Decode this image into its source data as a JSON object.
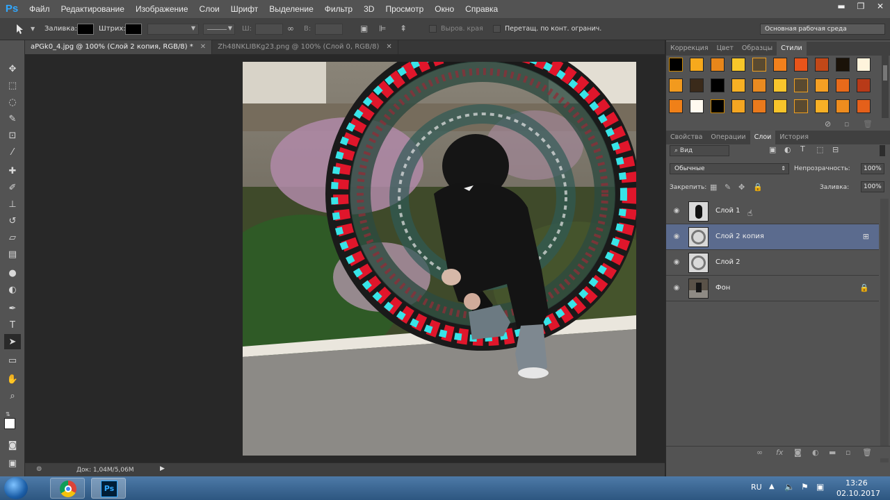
{
  "menubar": {
    "logo": "Ps",
    "items": [
      "Файл",
      "Редактирование",
      "Изображение",
      "Слои",
      "Шрифт",
      "Выделение",
      "Фильтр",
      "3D",
      "Просмотр",
      "Окно",
      "Справка"
    ]
  },
  "options": {
    "fill_label": "Заливка:",
    "stroke_label": "Штрих:",
    "w_label": "Ш:",
    "h_label": "В:",
    "align_edges_label": "Выров. края",
    "constrain_label": "Перетащ. по конт. огранич."
  },
  "tabs": [
    {
      "label": "aPGk0_4.jpg @ 100% (Слой 2 копия, RGB/8) *",
      "active": true
    },
    {
      "label": "Zh48NKLIBKg23.png @ 100% (Слой 0, RGB/8)",
      "active": false
    }
  ],
  "status": {
    "doc": "Док: 1,04M/5,06M"
  },
  "workspace": "Основная рабочая среда",
  "style_panel_tabs": [
    "Коррекция",
    "Цвет",
    "Образцы",
    "Стили"
  ],
  "layers_panel_tabs": [
    "Свойства",
    "Операции",
    "Слои",
    "История"
  ],
  "layers_panel": {
    "filter": "Вид",
    "blend_mode": "Обычные",
    "opacity_label": "Непрозрачность:",
    "opacity": "100%",
    "lock_label": "Закрепить:",
    "fill_label": "Заливка:",
    "fill": "100%",
    "layers": [
      {
        "name": "Слой 1",
        "selected": false
      },
      {
        "name": "Слой 2 копия",
        "selected": true
      },
      {
        "name": "Слой 2",
        "selected": false
      },
      {
        "name": "Фон",
        "selected": false
      }
    ]
  },
  "taskbar": {
    "lang": "RU",
    "time": "13:26",
    "date": "02.10.2017",
    "ps_icon": "Ps"
  },
  "colors": {
    "ps_blue": "#31a8ff",
    "selected_layer": "#5b6b8e",
    "accent_red": "#e0162b",
    "accent_cyan": "#38e4e8"
  }
}
